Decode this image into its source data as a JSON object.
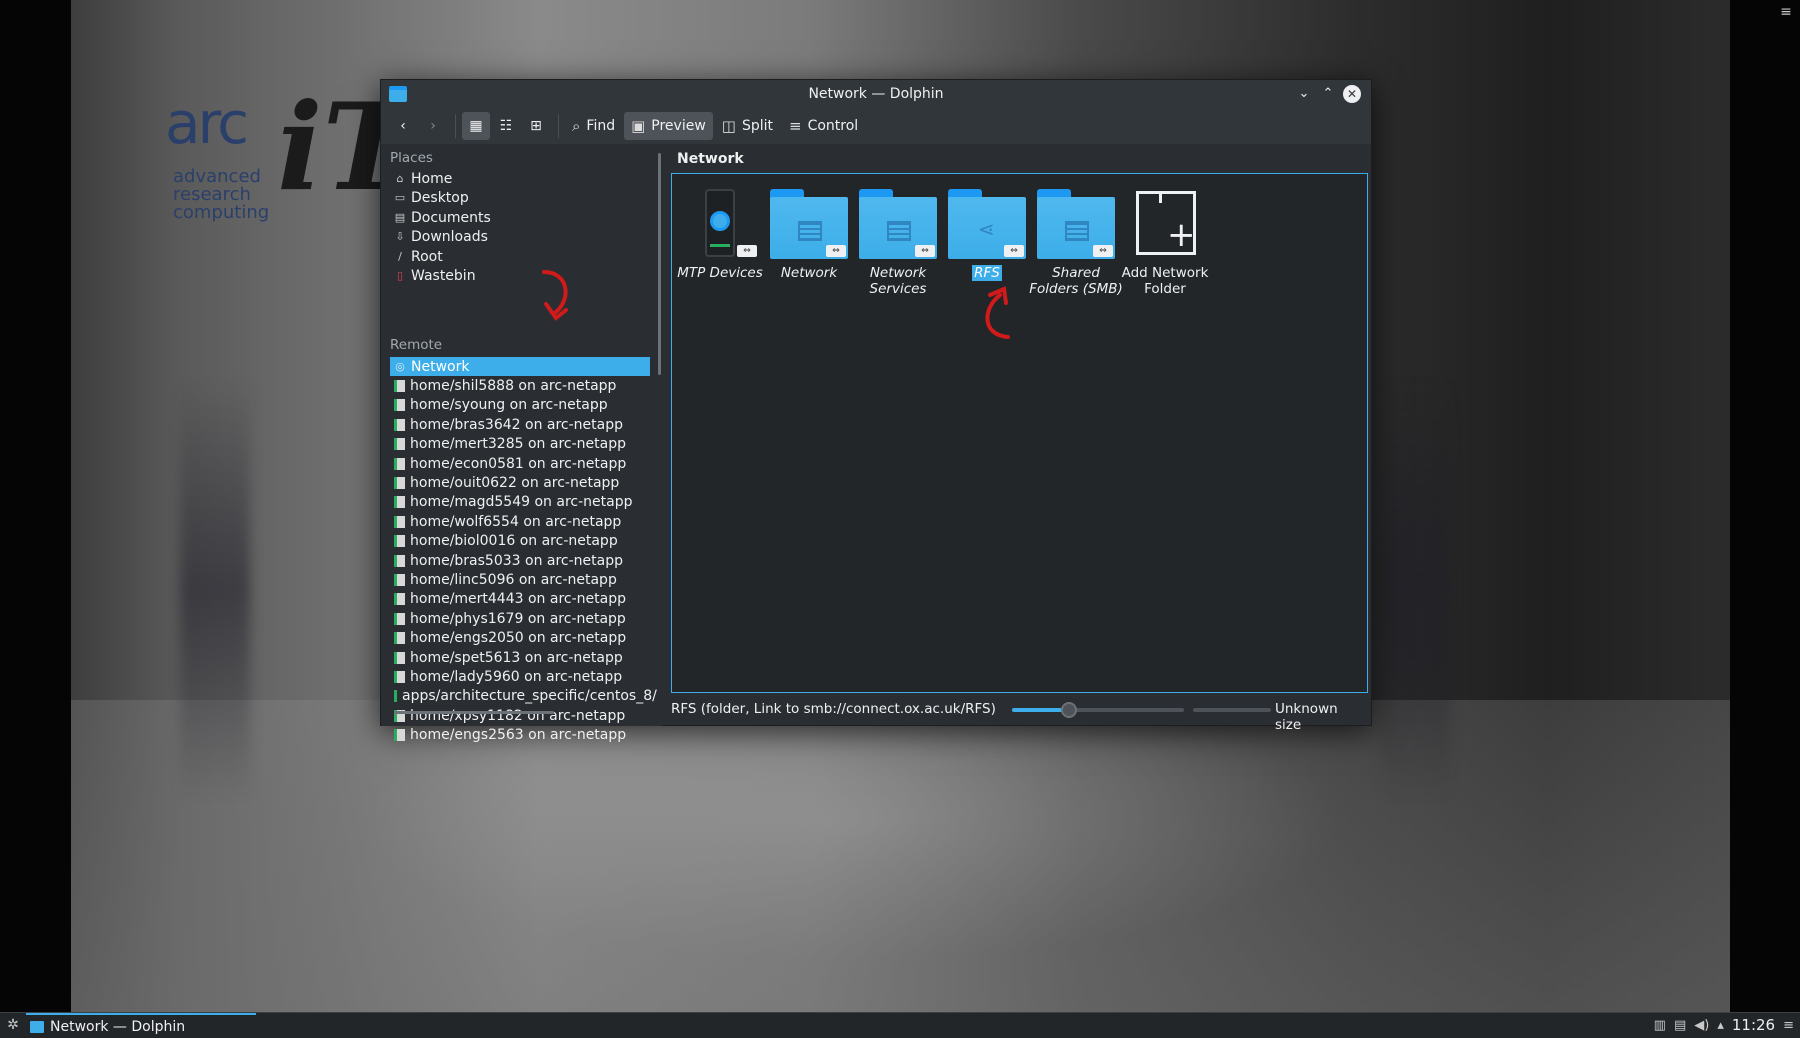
{
  "window": {
    "title": "Network — Dolphin"
  },
  "toolbar": {
    "find_label": "Find",
    "preview_label": "Preview",
    "split_label": "Split",
    "control_label": "Control"
  },
  "sidebar": {
    "places_heading": "Places",
    "places": [
      {
        "label": "Home",
        "icon": "home-icon"
      },
      {
        "label": "Desktop",
        "icon": "desktop-icon"
      },
      {
        "label": "Documents",
        "icon": "documents-icon"
      },
      {
        "label": "Downloads",
        "icon": "downloads-icon"
      },
      {
        "label": "Root",
        "icon": "root-icon"
      },
      {
        "label": "Wastebin",
        "icon": "trash-icon"
      }
    ],
    "remote_heading": "Remote",
    "remote": [
      {
        "label": "Network",
        "selected": true
      },
      {
        "label": "home/shil5888 on arc-netapp"
      },
      {
        "label": "home/syoung on arc-netapp"
      },
      {
        "label": "home/bras3642 on arc-netapp"
      },
      {
        "label": "home/mert3285 on arc-netapp"
      },
      {
        "label": "home/econ0581 on arc-netapp"
      },
      {
        "label": "home/ouit0622 on arc-netapp"
      },
      {
        "label": "home/magd5549 on arc-netapp"
      },
      {
        "label": "home/wolf6554 on arc-netapp"
      },
      {
        "label": "home/biol0016 on arc-netapp"
      },
      {
        "label": "home/bras5033 on arc-netapp"
      },
      {
        "label": "home/linc5096 on arc-netapp"
      },
      {
        "label": "home/mert4443 on arc-netapp"
      },
      {
        "label": "home/phys1679 on arc-netapp"
      },
      {
        "label": "home/engs2050 on arc-netapp"
      },
      {
        "label": "home/spet5613 on arc-netapp"
      },
      {
        "label": "home/lady5960 on arc-netapp"
      },
      {
        "label": "apps/architecture_specific/centos_8/"
      },
      {
        "label": "home/xpsy1182 on arc-netapp"
      },
      {
        "label": "home/engs2563 on arc-netapp"
      }
    ]
  },
  "main": {
    "location": "Network",
    "items": [
      {
        "label": "MTP Devices",
        "kind": "mtp"
      },
      {
        "label": "Network",
        "kind": "server-folder"
      },
      {
        "label": "Network Services",
        "label_line1": "Network",
        "label_line2": "Services",
        "kind": "server-folder"
      },
      {
        "label": "RFS",
        "kind": "share-folder",
        "selected": true
      },
      {
        "label": "Shared Folders (SMB)",
        "label_line1": "Shared",
        "label_line2": "Folders (SMB)",
        "kind": "server-folder"
      },
      {
        "label": "Add Network Folder",
        "label_line1": "Add Network",
        "label_line2": "Folder",
        "kind": "add-folder"
      }
    ]
  },
  "statusbar": {
    "text": "RFS (folder, Link to smb://connect.ox.ac.uk/RFS)",
    "zoom_fraction": 0.33,
    "space_text": "Unknown size"
  },
  "logo": {
    "arc": "arc",
    "line1": "advanced",
    "line2": "research",
    "line3": "computing",
    "it": "iT"
  },
  "taskbar": {
    "task_label": "Network — Dolphin",
    "clock": "11:26"
  },
  "colors": {
    "accent": "#3daee9",
    "window_bg": "#2a2e32",
    "annotation_arrow": "#d11a1a"
  }
}
